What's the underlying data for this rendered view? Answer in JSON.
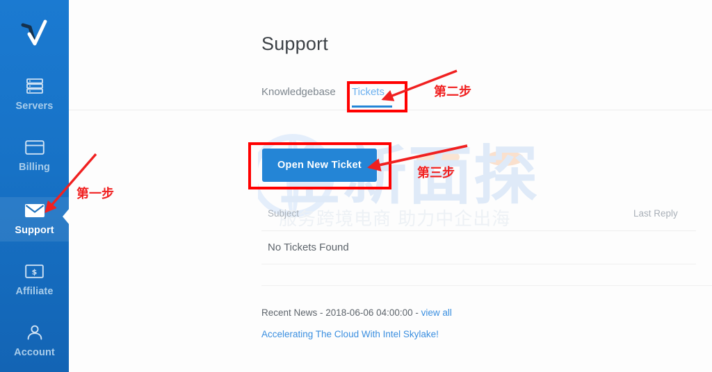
{
  "sidebar": {
    "logo_icon": "checkmark-radical-logo",
    "items": [
      {
        "label": "Servers",
        "icon": "servers-icon",
        "active": false
      },
      {
        "label": "Billing",
        "icon": "credit-card-icon",
        "active": false
      },
      {
        "label": "Support",
        "icon": "envelope-icon",
        "active": true
      },
      {
        "label": "Affiliate",
        "icon": "dollar-bill-icon",
        "active": false
      },
      {
        "label": "Account",
        "icon": "person-icon",
        "active": false
      }
    ]
  },
  "main": {
    "page_title": "Support",
    "tabs": [
      {
        "label": "Knowledgebase",
        "active": false
      },
      {
        "label": "Tickets",
        "active": true
      }
    ],
    "open_ticket_button": "Open New Ticket",
    "table": {
      "columns": [
        "Subject",
        "Last Reply"
      ],
      "empty_message": "No Tickets Found"
    },
    "news": {
      "prefix": "Recent News - ",
      "timestamp": "2018-06-06 04:00:00",
      "separator": " - ",
      "view_all": "view all",
      "headline": "Accelerating The Cloud With Intel Skylake!"
    }
  },
  "watermark": {
    "big_text": "全新面探",
    "small_text": "服务跨境电商  助力中企出海"
  },
  "annotations": [
    {
      "id": "step-one",
      "text": "第一步"
    },
    {
      "id": "step-two",
      "text": "第二步"
    },
    {
      "id": "step-three",
      "text": "第三步"
    }
  ],
  "colors": {
    "sidebar_blue": "#1772c6",
    "accent_blue": "#2485d6",
    "tab_active": "#6cb0ef",
    "link_blue": "#3b8fe0",
    "annotation_red": "#ff0000"
  }
}
